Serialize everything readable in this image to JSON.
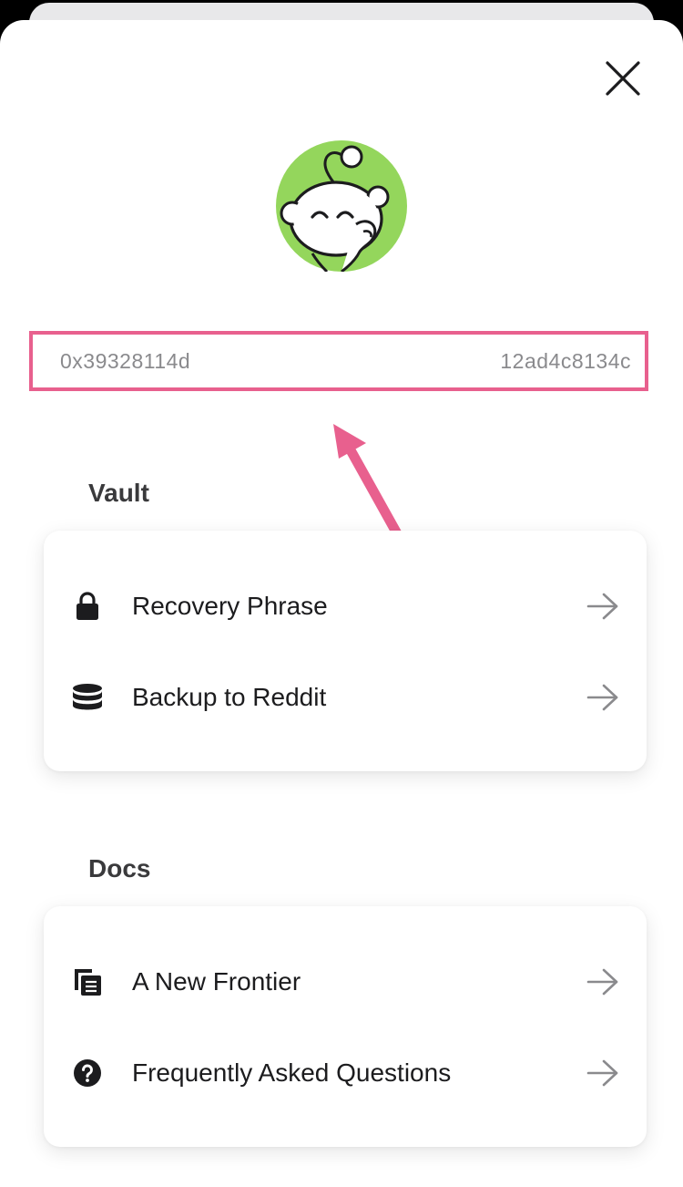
{
  "wallet": {
    "address_start": "0x39328114d",
    "address_end": "12ad4c8134c"
  },
  "icons": {
    "close": "close-icon",
    "avatar": "snoo-avatar",
    "arrow": "arrow-right-icon"
  },
  "colors": {
    "highlight": "#e8608e",
    "avatar_bg": "#94d65c",
    "text_primary": "#1c1c1e",
    "text_muted": "#8a8a8d"
  },
  "vault": {
    "title": "Vault",
    "items": [
      {
        "label": "Recovery Phrase",
        "icon": "lock-icon"
      },
      {
        "label": "Backup to Reddit",
        "icon": "database-icon"
      }
    ]
  },
  "docs": {
    "title": "Docs",
    "items": [
      {
        "label": "A New Frontier",
        "icon": "document-stack-icon"
      },
      {
        "label": "Frequently Asked Questions",
        "icon": "question-circle-icon"
      }
    ]
  }
}
